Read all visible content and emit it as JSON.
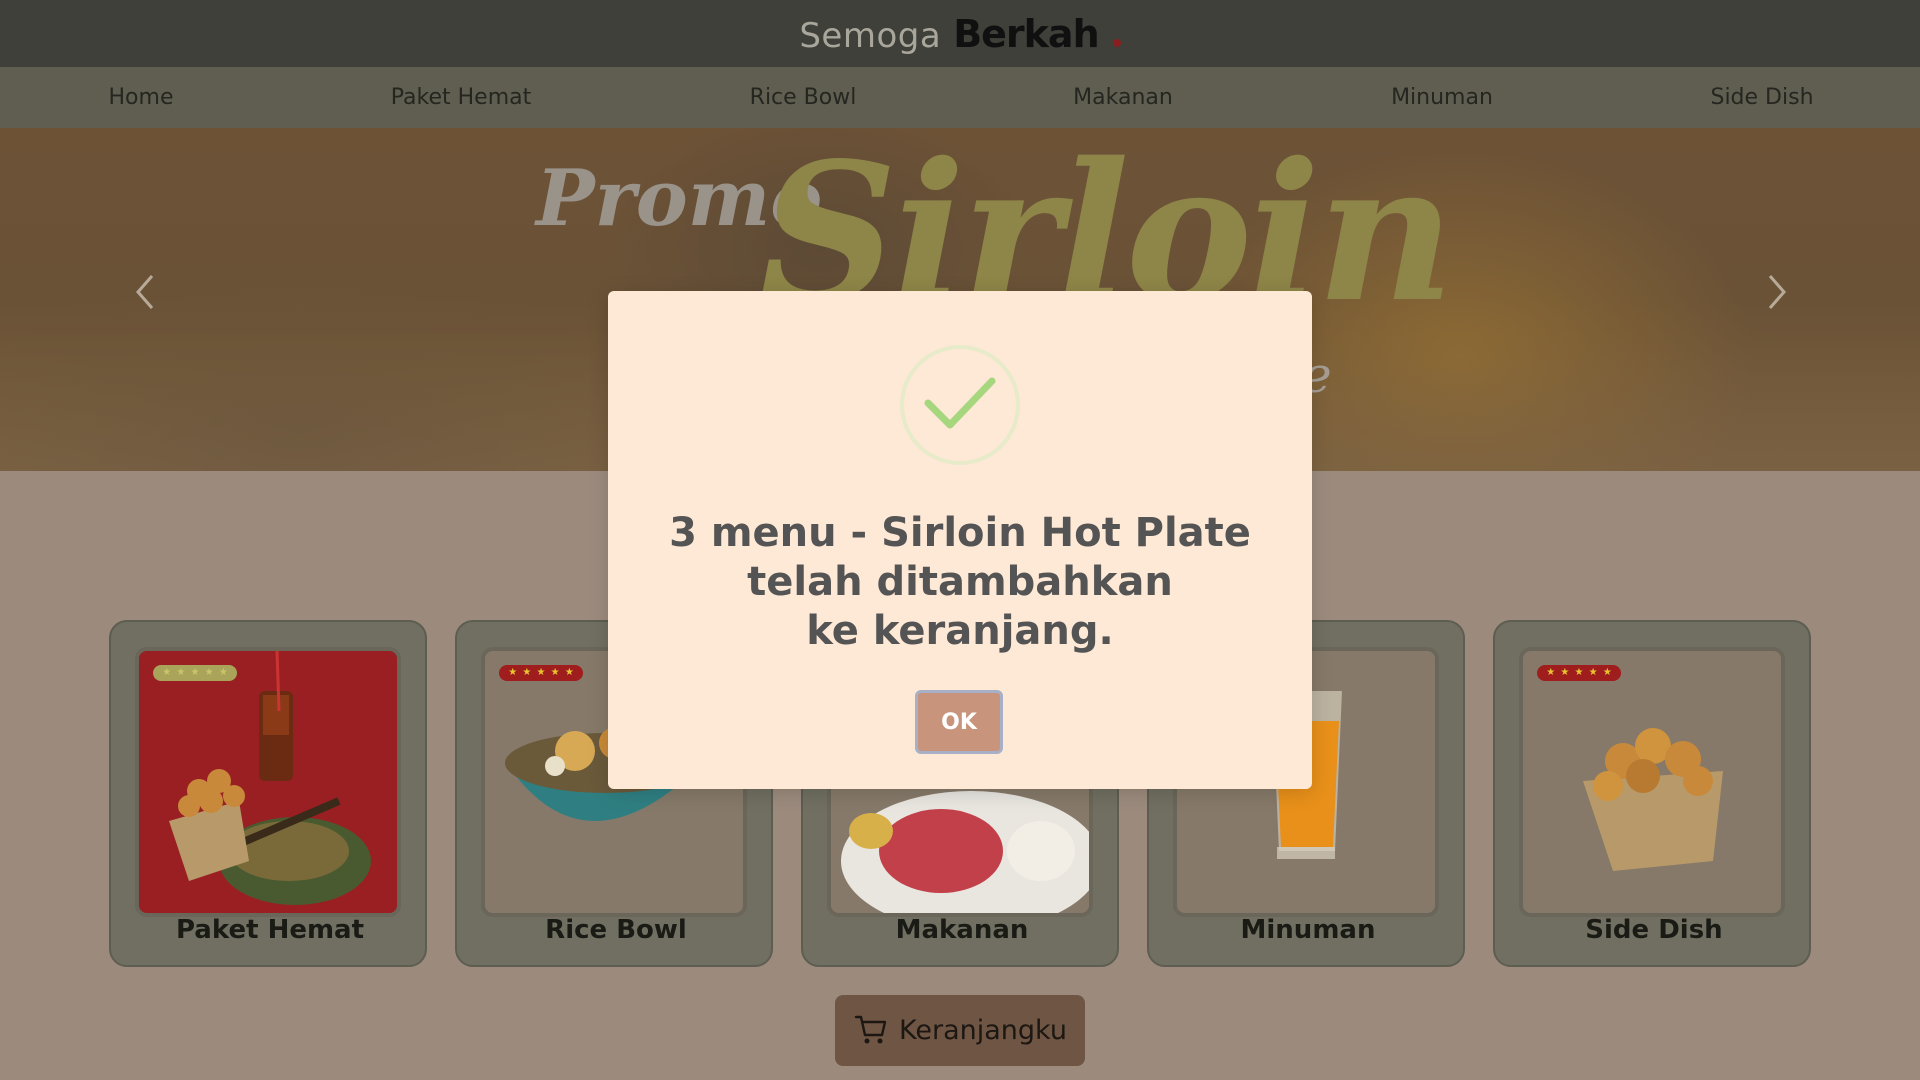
{
  "header": {
    "brand_prefix": "Semoga",
    "brand_name": "Berkah"
  },
  "nav": {
    "items": [
      {
        "label": "Home"
      },
      {
        "label": "Paket Hemat"
      },
      {
        "label": "Rice Bowl"
      },
      {
        "label": "Makanan"
      },
      {
        "label": "Minuman"
      },
      {
        "label": "Side Dish"
      }
    ]
  },
  "hero": {
    "word_promo": "Promo",
    "word_sirloin": "Sirloin",
    "word_partial": "te"
  },
  "categories": [
    {
      "label": "Paket Hemat",
      "rating": 5
    },
    {
      "label": "Rice Bowl",
      "rating": 5
    },
    {
      "label": "Makanan"
    },
    {
      "label": "Minuman"
    },
    {
      "label": "Side Dish",
      "rating": 5
    }
  ],
  "cart": {
    "label": "Keranjangku"
  },
  "modal": {
    "line1": "3 menu - Sirloin Hot Plate",
    "line2": "telah ditambahkan",
    "line3": "ke keranjang.",
    "ok_label": "OK"
  },
  "colors": {
    "header_bg": "#3f403a",
    "nav_bg": "#5f5e51",
    "modal_bg": "#fee8d6",
    "ok_button": "#c8957c",
    "success_check": "#a6d67e",
    "cart_button": "#6e5544"
  }
}
